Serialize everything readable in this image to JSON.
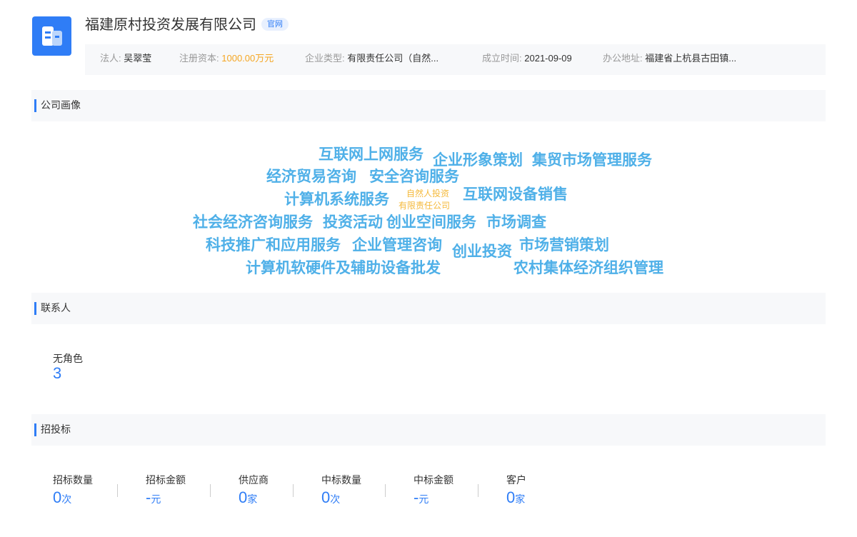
{
  "header": {
    "company_name": "福建原村投资发展有限公司",
    "website_badge": "官网",
    "info": [
      {
        "key": "法人:",
        "value": "吴翠莹"
      },
      {
        "key": "注册资本:",
        "value": "1000.00万元"
      },
      {
        "key": "企业类型:",
        "value": "有限责任公司（自然..."
      },
      {
        "key": "成立时间:",
        "value": "2021-09-09"
      },
      {
        "key": "办公地址:",
        "value": "福建省上杭县古田镇..."
      }
    ]
  },
  "sections": {
    "portrait": "公司画像",
    "contacts": "联系人",
    "bidding": "招投标"
  },
  "word_cloud": [
    "互联网上网服务",
    "企业形象策划",
    "集贸市场管理服务",
    "经济贸易咨询",
    "安全咨询服务",
    "计算机系统服务",
    "自然人投资",
    "有限责任公司",
    "互联网设备销售",
    "社会经济咨询服务",
    "投资活动",
    "创业空间服务",
    "市场调查",
    "科技推广和应用服务",
    "企业管理咨询",
    "创业投资",
    "市场营销策划",
    "计算机软硬件及辅助设备批发",
    "农村集体经济组织管理"
  ],
  "contacts": {
    "role_label": "无角色",
    "role_count": "3"
  },
  "bidding_stats": [
    {
      "label": "招标数量",
      "value": "0",
      "unit": "次"
    },
    {
      "label": "招标金额",
      "value": "-",
      "unit": "元"
    },
    {
      "label": "供应商",
      "value": "0",
      "unit": "家"
    },
    {
      "label": "中标数量",
      "value": "0",
      "unit": "次"
    },
    {
      "label": "中标金额",
      "value": "-",
      "unit": "元"
    },
    {
      "label": "客户",
      "value": "0",
      "unit": "家"
    }
  ],
  "colors": {
    "accent": "#2f7df6",
    "cloud_word": "#4fb0e8",
    "cloud_small": "#f5b93a",
    "capital": "#f5a623"
  },
  "icons": {
    "logo": "building-icon"
  }
}
